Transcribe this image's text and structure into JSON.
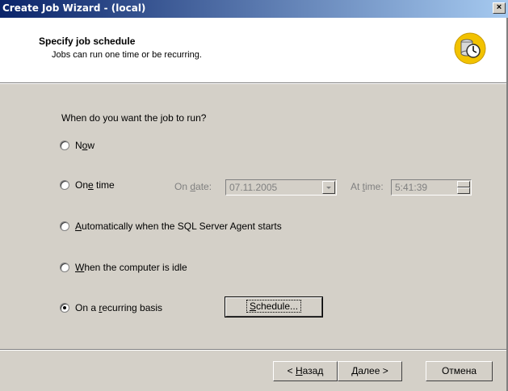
{
  "window": {
    "title": "Create Job Wizard - (local)",
    "close_glyph": "×"
  },
  "header": {
    "title": "Specify job schedule",
    "subtitle": "Jobs can run one time or be recurring."
  },
  "question": "When do you want the job to run?",
  "options": {
    "now": {
      "pre": "N",
      "u": "o",
      "post": "w",
      "checked": false
    },
    "one_time": {
      "pre": "On",
      "u": "e",
      "post": " time",
      "checked": false
    },
    "agent_start": {
      "pre": "",
      "u": "A",
      "post": "utomatically when the SQL Server Agent starts",
      "checked": false
    },
    "idle": {
      "pre": "",
      "u": "W",
      "post": "hen the computer is idle",
      "checked": false
    },
    "recurring": {
      "pre": "On a ",
      "u": "r",
      "post": "ecurring basis",
      "checked": true
    }
  },
  "one_time_fields": {
    "date_label_pre": "On ",
    "date_label_u": "d",
    "date_label_post": "ate:",
    "date_value": "07.11.2005",
    "time_label_pre": "At ",
    "time_label_u": "t",
    "time_label_post": "ime:",
    "time_value": "5:41:39"
  },
  "schedule_button": {
    "u": "S",
    "rest": "chedule..."
  },
  "footer": {
    "back": {
      "pre": "< ",
      "u": "Н",
      "post": "азад"
    },
    "next": {
      "pre": "",
      "u": "Д",
      "post": "алее >"
    },
    "cancel": "Отмена"
  },
  "colors": {
    "title_gradient_start": "#0a246a",
    "title_gradient_end": "#a6caf0",
    "face": "#d4d0c8"
  }
}
